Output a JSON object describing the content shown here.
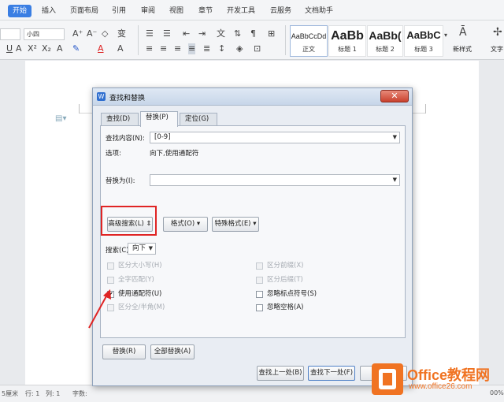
{
  "colors": {
    "accent": "#3a7ee3",
    "highlight": "#e02424",
    "watermark": "#f07322"
  },
  "menubar": {
    "items": [
      "开始",
      "插入",
      "页面布局",
      "引用",
      "审阅",
      "视图",
      "章节",
      "开发工具",
      "云服务",
      "文档助手"
    ],
    "active": "开始"
  },
  "toolbar": {
    "font_size": "小四",
    "styles": [
      {
        "sample": "AaBbCcDd",
        "name": "正文"
      },
      {
        "sample": "AaBb",
        "name": "标题 1"
      },
      {
        "sample": "AaBb(",
        "name": "标题 2"
      },
      {
        "sample": "AaBbC",
        "name": "标题 3"
      }
    ],
    "new_style": "新样式",
    "text_tool": "文字"
  },
  "dialog": {
    "title": "查找和替换",
    "close_icon": "close-icon",
    "tabs": [
      "查找(D)",
      "替换(P)",
      "定位(G)"
    ],
    "active_tab": "替换(P)",
    "find_label": "查找内容(N):",
    "find_value": "[0-9]",
    "options_label": "选项:",
    "options_value": "向下,使用通配符",
    "replace_label": "替换为(I):",
    "replace_value": "",
    "advanced_btn": "高级搜索(L) ⇕",
    "format_btn": "格式(O) ▾",
    "special_btn": "特殊格式(E) ▾",
    "search_label": "搜索(C)",
    "search_value": "向下",
    "checkboxes_left": [
      {
        "label": "区分大小写(H)",
        "checked": false,
        "enabled": false
      },
      {
        "label": "全字匹配(Y)",
        "checked": false,
        "enabled": false
      },
      {
        "label": "使用通配符(U)",
        "checked": true,
        "enabled": true
      },
      {
        "label": "区分全/半角(M)",
        "checked": false,
        "enabled": false
      }
    ],
    "checkboxes_right": [
      {
        "label": "区分前缀(X)",
        "checked": false,
        "enabled": false
      },
      {
        "label": "区分后缀(T)",
        "checked": false,
        "enabled": false
      },
      {
        "label": "忽略标点符号(S)",
        "checked": false,
        "enabled": true
      },
      {
        "label": "忽略空格(A)",
        "checked": false,
        "enabled": true
      }
    ],
    "replace_btn": "替换(R)",
    "replace_all_btn": "全部替换(A)",
    "find_prev_btn": "查找上一处(B)",
    "find_next_btn": "查找下一处(F)"
  },
  "statusbar": {
    "unit": "5厘米",
    "row": "行: 1",
    "col": "列: 1",
    "words": "字数:",
    "zoom": "00%"
  },
  "watermark": {
    "title": "Office教程网",
    "url": "www.office26.com"
  }
}
